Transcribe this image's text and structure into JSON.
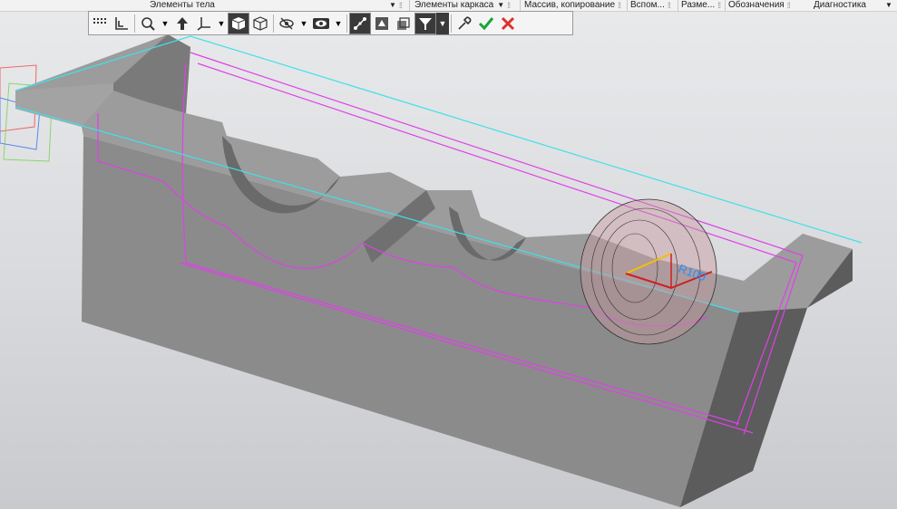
{
  "ribbon": {
    "groups": [
      {
        "label": "Элементы тела"
      },
      {
        "label": "Элементы каркаса"
      },
      {
        "label": "Массив, копирование"
      },
      {
        "label": "Вспом..."
      },
      {
        "label": "Разме..."
      },
      {
        "label": "Обозначения"
      },
      {
        "label": "Диагностика"
      }
    ]
  },
  "toolbar": {
    "buttons": [
      {
        "icon": "grid-menu-icon"
      },
      {
        "icon": "sketch-icon"
      },
      {
        "icon": "zoom-icon"
      },
      {
        "icon": "orient-icon"
      },
      {
        "icon": "axes-icon"
      },
      {
        "icon": "shaded-cube-icon"
      },
      {
        "icon": "wireframe-cube-icon"
      },
      {
        "icon": "hide-icon"
      },
      {
        "icon": "visibility-icon"
      },
      {
        "icon": "snap-icon"
      },
      {
        "icon": "select-body-icon"
      },
      {
        "icon": "layers-icon"
      },
      {
        "icon": "filter-icon"
      },
      {
        "icon": "eyedropper-icon"
      },
      {
        "icon": "apply-check-icon"
      },
      {
        "icon": "cancel-x-icon"
      }
    ],
    "colors": {
      "apply": "#1aa33a",
      "cancel": "#e0302a",
      "active": "#3a3a3a"
    }
  },
  "viewport": {
    "colors": {
      "body_face": "#8b8b8b",
      "body_top": "#9a9a9a",
      "body_dark": "#5a5a5a",
      "edge_magenta": "#e040e8",
      "edge_cyan": "#40e0e8",
      "sphere": "#c89aa0",
      "dimension": "#1e90ff"
    },
    "dimension_label": "R100"
  }
}
